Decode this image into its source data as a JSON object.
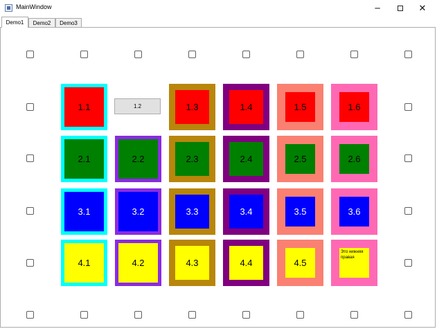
{
  "window": {
    "title": "MainWindow",
    "min": "─",
    "close": "✕"
  },
  "tabs": [
    {
      "label": "Demo1",
      "active": true
    },
    {
      "label": "Demo2",
      "active": false
    },
    {
      "label": "Demo3",
      "active": false
    }
  ],
  "grid": {
    "button_1_2": "1.2",
    "note_text": "Это нижняя правая",
    "cells": [
      {
        "id": "1.1",
        "label": "1.1",
        "fill": "#ff0000",
        "frame": "#00ffff",
        "text": "#000000"
      },
      {
        "id": "1.3",
        "label": "1.3",
        "fill": "#ff0000",
        "frame": "#b8860b",
        "text": "#000000"
      },
      {
        "id": "1.4",
        "label": "1.4",
        "fill": "#ff0000",
        "frame": "#800080",
        "text": "#000000"
      },
      {
        "id": "1.5",
        "label": "1.5",
        "fill": "#ff0000",
        "frame": "#fa8072",
        "text": "#000000"
      },
      {
        "id": "1.6",
        "label": "1.6",
        "fill": "#ff0000",
        "frame": "#ff69b4",
        "text": "#000000"
      },
      {
        "id": "2.1",
        "label": "2.1",
        "fill": "#008000",
        "frame": "#00ffff",
        "text": "#000000"
      },
      {
        "id": "2.2",
        "label": "2.2",
        "fill": "#008000",
        "frame": "#8a2be2",
        "text": "#000000"
      },
      {
        "id": "2.3",
        "label": "2.3",
        "fill": "#008000",
        "frame": "#b8860b",
        "text": "#000000"
      },
      {
        "id": "2.4",
        "label": "2.4",
        "fill": "#008000",
        "frame": "#800080",
        "text": "#000000"
      },
      {
        "id": "2.5",
        "label": "2.5",
        "fill": "#008000",
        "frame": "#fa8072",
        "text": "#000000"
      },
      {
        "id": "2.6",
        "label": "2.6",
        "fill": "#008000",
        "frame": "#ff69b4",
        "text": "#000000"
      },
      {
        "id": "3.1",
        "label": "3.1",
        "fill": "#0000ff",
        "frame": "#00ffff",
        "text": "#ffffff"
      },
      {
        "id": "3.2",
        "label": "3.2",
        "fill": "#0000ff",
        "frame": "#8a2be2",
        "text": "#ffffff"
      },
      {
        "id": "3.3",
        "label": "3.3",
        "fill": "#0000ff",
        "frame": "#b8860b",
        "text": "#ffffff"
      },
      {
        "id": "3.4",
        "label": "3.4",
        "fill": "#0000ff",
        "frame": "#800080",
        "text": "#ffffff"
      },
      {
        "id": "3.5",
        "label": "3.5",
        "fill": "#0000ff",
        "frame": "#fa8072",
        "text": "#ffffff"
      },
      {
        "id": "3.6",
        "label": "3.6",
        "fill": "#0000ff",
        "frame": "#ff69b4",
        "text": "#ffffff"
      },
      {
        "id": "4.1",
        "label": "4.1",
        "fill": "#ffff00",
        "frame": "#00ffff",
        "text": "#000000"
      },
      {
        "id": "4.2",
        "label": "4.2",
        "fill": "#ffff00",
        "frame": "#8a2be2",
        "text": "#000000"
      },
      {
        "id": "4.3",
        "label": "4.3",
        "fill": "#ffff00",
        "frame": "#b8860b",
        "text": "#000000"
      },
      {
        "id": "4.4",
        "label": "4.4",
        "fill": "#ffff00",
        "frame": "#800080",
        "text": "#000000"
      },
      {
        "id": "4.5",
        "label": "4.5",
        "fill": "#ffff00",
        "frame": "#fa8072",
        "text": "#000000"
      }
    ],
    "note_cell": {
      "fill": "#ffff00",
      "frame": "#ff69b4"
    }
  }
}
